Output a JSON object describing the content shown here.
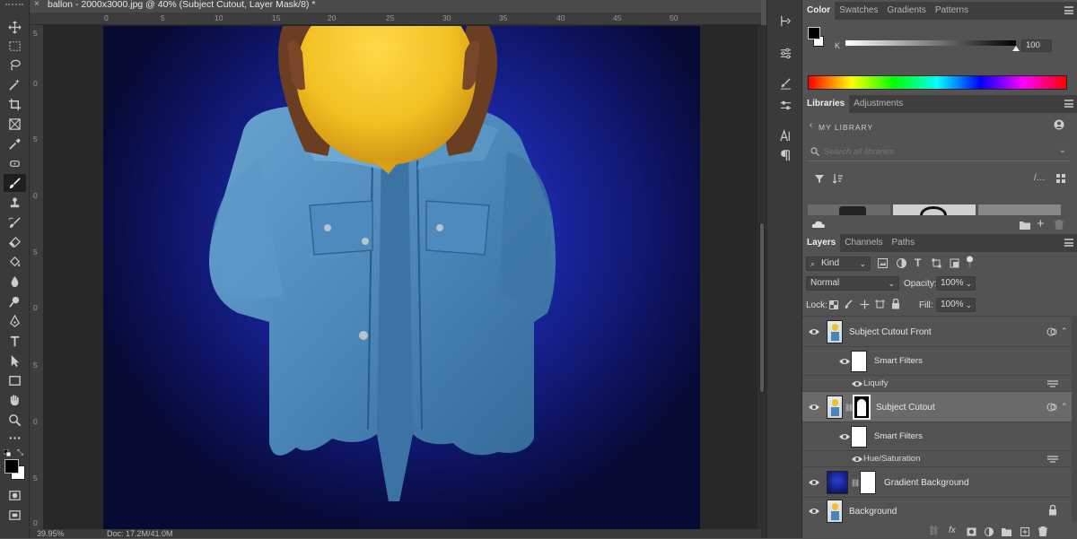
{
  "document": {
    "tab_title": "ballon - 2000x3000.jpg @ 40% (Subject Cutout, Layer Mask/8) *",
    "close_glyph": "×",
    "ruler_top_ticks": [
      "0",
      "5",
      "10",
      "15",
      "20",
      "25",
      "30",
      "35",
      "40",
      "45",
      "50"
    ],
    "ruler_left_ticks": [
      "5",
      "0",
      "5",
      "0",
      "5",
      "0",
      "5",
      "0",
      "5",
      "0",
      "5",
      "0"
    ],
    "zoom": "39.95%",
    "doc_info": "Doc: 17.2M/41.0M"
  },
  "toolbar": {
    "tools": [
      "move",
      "marquee",
      "lasso",
      "magic-wand",
      "crop",
      "frame",
      "eyedropper",
      "healing",
      "brush",
      "stamp",
      "history-brush",
      "eraser",
      "paint-bucket",
      "blur",
      "dodge",
      "pen",
      "type",
      "path-select",
      "rectangle",
      "hand",
      "zoom",
      "more"
    ],
    "active_tool": "brush",
    "foreground_color": "#000000",
    "background_color": "#ffffff"
  },
  "color_panel": {
    "tabs": [
      "Color",
      "Swatches",
      "Gradients",
      "Patterns"
    ],
    "active_tab": "Color",
    "channel_label": "K",
    "value": "100"
  },
  "libraries_panel": {
    "tabs": [
      "Libraries",
      "Adjustments"
    ],
    "active_tab": "Libraries",
    "library_name": "MY LIBRARY",
    "search_placeholder": "Search all libraries"
  },
  "layers_panel": {
    "tabs": [
      "Layers",
      "Channels",
      "Paths"
    ],
    "active_tab": "Layers",
    "filter_kind": "Kind",
    "blend_mode": "Normal",
    "opacity_label": "Opacity:",
    "opacity_value": "100%",
    "lock_label": "Lock:",
    "fill_label": "Fill:",
    "fill_value": "100%",
    "layers": [
      {
        "name": "Subject Cutout Front",
        "type": "smart-object"
      },
      {
        "name": "Smart Filters",
        "type": "smart-filters"
      },
      {
        "name": "Liquify",
        "type": "filter"
      },
      {
        "name": "Subject Cutout",
        "type": "smart-object-mask",
        "selected": true
      },
      {
        "name": "Smart Filters",
        "type": "smart-filters"
      },
      {
        "name": "Hue/Saturation",
        "type": "filter"
      },
      {
        "name": "Gradient Background",
        "type": "fill-mask"
      },
      {
        "name": "Background",
        "type": "background"
      }
    ]
  },
  "colors": {
    "ui_dark": "#3a3a3a",
    "ui_panel": "#535353",
    "canvas_bg": "#282828",
    "selected_layer": "#6a6a6a",
    "balloon": "#f2c022",
    "denim": "#4a86b8"
  }
}
